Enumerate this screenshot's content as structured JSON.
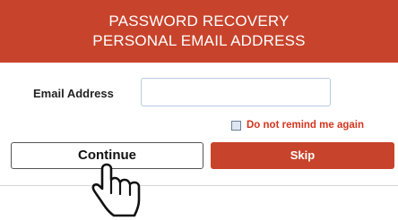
{
  "dialog": {
    "title_line1": "PASSWORD RECOVERY",
    "title_line2": "PERSONAL EMAIL ADDRESS"
  },
  "form": {
    "email_label": "Email Address",
    "email_value": "",
    "remind_label": "Do not remind me again",
    "remind_checked": false
  },
  "actions": {
    "continue_label": "Continue",
    "skip_label": "Skip"
  },
  "colors": {
    "accent": "#c8432b",
    "input_border": "#b8cbe2",
    "warning_text": "#d4351f"
  },
  "pointer": {
    "icon": "hand-pointer-icon"
  }
}
